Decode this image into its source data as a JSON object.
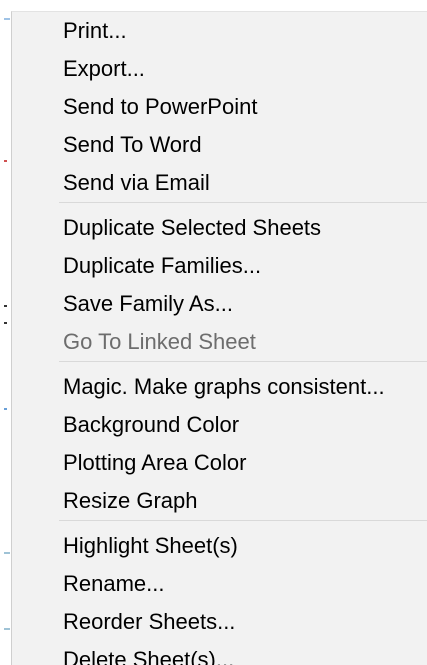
{
  "menu": {
    "items": [
      {
        "label": "Print...",
        "enabled": true
      },
      {
        "label": "Export...",
        "enabled": true
      },
      {
        "label": "Send to PowerPoint",
        "enabled": true
      },
      {
        "label": "Send To Word",
        "enabled": true
      },
      {
        "label": "Send via Email",
        "enabled": true
      },
      {
        "label": "Duplicate Selected Sheets",
        "enabled": true
      },
      {
        "label": "Duplicate Families...",
        "enabled": true
      },
      {
        "label": "Save Family As...",
        "enabled": true
      },
      {
        "label": "Go To Linked Sheet",
        "enabled": false
      },
      {
        "label": "Magic. Make graphs consistent...",
        "enabled": true
      },
      {
        "label": "Background Color",
        "enabled": true
      },
      {
        "label": "Plotting Area Color",
        "enabled": true
      },
      {
        "label": "Resize Graph",
        "enabled": true
      },
      {
        "label": "Highlight Sheet(s)",
        "enabled": true
      },
      {
        "label": "Rename...",
        "enabled": true
      },
      {
        "label": "Reorder Sheets...",
        "enabled": true
      },
      {
        "label": "Delete Sheet(s)...",
        "enabled": true
      }
    ]
  },
  "colors": {
    "menu_background": "#f2f2f2",
    "text": "#000000",
    "disabled_text": "#6d6d6d",
    "separator": "#d9d9d9"
  }
}
